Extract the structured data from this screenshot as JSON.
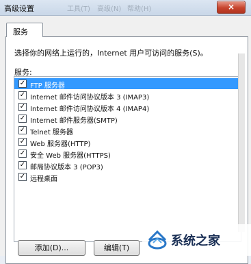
{
  "window": {
    "title": "高级设置",
    "blurred_title_parts": [
      "工具(T)",
      "高级(N)",
      "帮助(H)"
    ],
    "close_label": "×"
  },
  "tabs": [
    {
      "label": "服务"
    }
  ],
  "panel": {
    "description": "选择你的网络上运行的，Internet 用户可访问的服务(S)。",
    "list_label": "服务:"
  },
  "services": [
    {
      "label": "FTP 服务器",
      "checked": true,
      "selected": true
    },
    {
      "label": "Internet 邮件访问协议版本 3 (IMAP3)",
      "checked": true,
      "selected": false
    },
    {
      "label": "Internet 邮件访问协议版本 4 (IMAP4)",
      "checked": true,
      "selected": false
    },
    {
      "label": "Internet 邮件服务器(SMTP)",
      "checked": true,
      "selected": false
    },
    {
      "label": "Telnet 服务器",
      "checked": true,
      "selected": false
    },
    {
      "label": "Web 服务器(HTTP)",
      "checked": true,
      "selected": false
    },
    {
      "label": "安全 Web 服务器(HTTPS)",
      "checked": true,
      "selected": false
    },
    {
      "label": "邮局协议版本 3 (POP3)",
      "checked": true,
      "selected": false
    },
    {
      "label": "远程桌面",
      "checked": true,
      "selected": false
    }
  ],
  "buttons": {
    "add": "添加(D)...",
    "edit": "编辑(T)"
  },
  "watermark": {
    "text": "系统之家"
  },
  "colors": {
    "selection": "#3399ff",
    "close_button": "#c7452e",
    "watermark_blue": "#2a78c8"
  }
}
